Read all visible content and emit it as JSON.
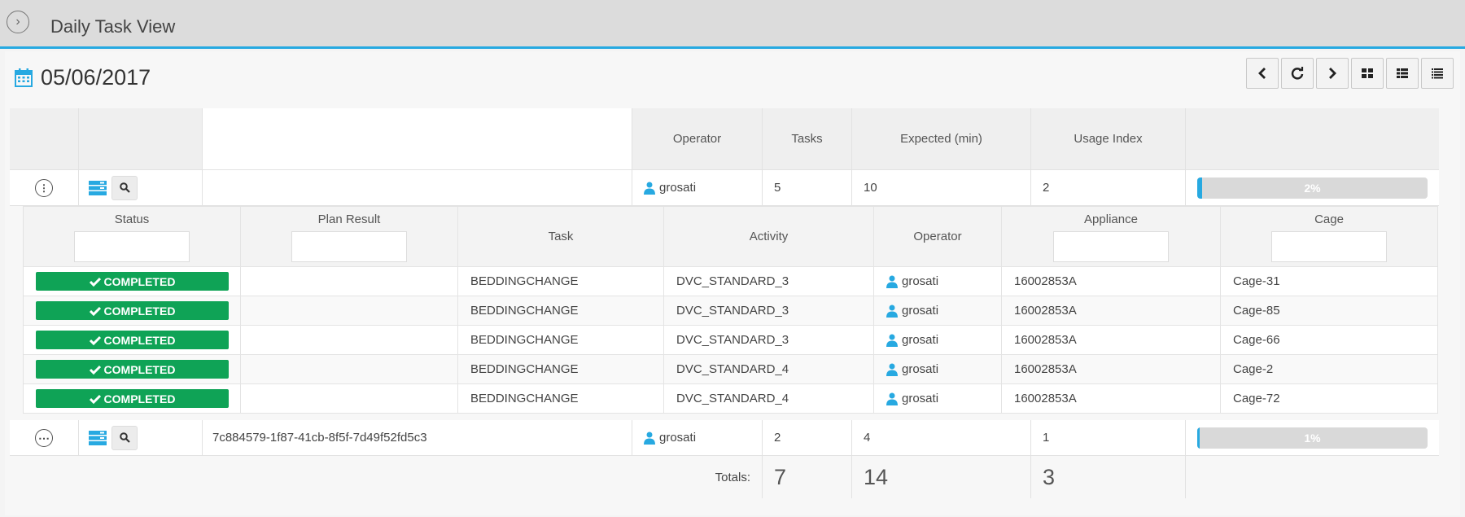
{
  "header": {
    "title": "Daily Task View"
  },
  "date": "05/06/2017",
  "toolbar": {
    "prev": "previous",
    "refresh": "refresh",
    "next": "next",
    "grid_view": "grid",
    "detail_view": "detail",
    "list_view": "list"
  },
  "table": {
    "headers": {
      "operator": "Operator",
      "tasks": "Tasks",
      "expected": "Expected (min)",
      "usage": "Usage Index"
    },
    "rows": [
      {
        "id": "",
        "operator": "grosati",
        "tasks": "5",
        "expected": "10",
        "usage": "2",
        "progress": 2,
        "progress_label": "2%"
      },
      {
        "id": "7c884579-1f87-41cb-8f5f-7d49f52fd5c3",
        "operator": "grosati",
        "tasks": "2",
        "expected": "4",
        "usage": "1",
        "progress": 1,
        "progress_label": "1%"
      }
    ],
    "totals": {
      "label": "Totals:",
      "tasks": "7",
      "expected": "14",
      "usage": "3"
    }
  },
  "details": {
    "headers": {
      "status": "Status",
      "plan_result": "Plan Result",
      "task": "Task",
      "activity": "Activity",
      "operator": "Operator",
      "appliance": "Appliance",
      "cage": "Cage"
    },
    "rows": [
      {
        "status": "COMPLETED",
        "plan_result": "",
        "task": "BEDDINGCHANGE",
        "activity": "DVC_STANDARD_3",
        "operator": "grosati",
        "appliance": "16002853A",
        "cage": "Cage-31"
      },
      {
        "status": "COMPLETED",
        "plan_result": "",
        "task": "BEDDINGCHANGE",
        "activity": "DVC_STANDARD_3",
        "operator": "grosati",
        "appliance": "16002853A",
        "cage": "Cage-85"
      },
      {
        "status": "COMPLETED",
        "plan_result": "",
        "task": "BEDDINGCHANGE",
        "activity": "DVC_STANDARD_3",
        "operator": "grosati",
        "appliance": "16002853A",
        "cage": "Cage-66"
      },
      {
        "status": "COMPLETED",
        "plan_result": "",
        "task": "BEDDINGCHANGE",
        "activity": "DVC_STANDARD_4",
        "operator": "grosati",
        "appliance": "16002853A",
        "cage": "Cage-2"
      },
      {
        "status": "COMPLETED",
        "plan_result": "",
        "task": "BEDDINGCHANGE",
        "activity": "DVC_STANDARD_4",
        "operator": "grosati",
        "appliance": "16002853A",
        "cage": "Cage-72"
      }
    ]
  },
  "colors": {
    "accent": "#27a9e1",
    "completed": "#0fa356"
  }
}
